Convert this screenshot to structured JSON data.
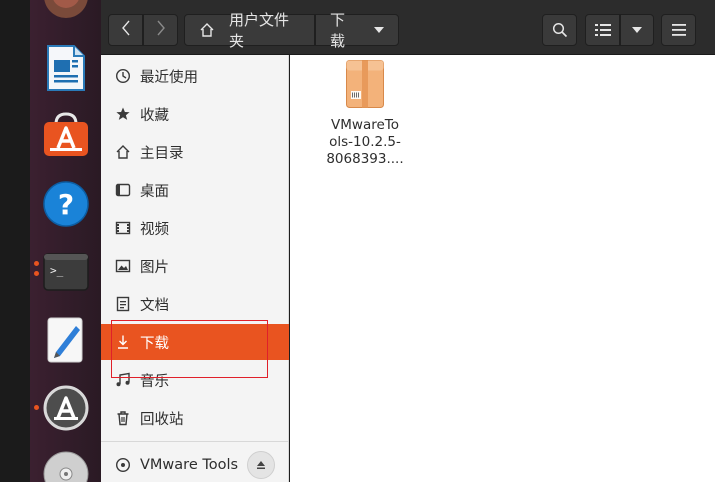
{
  "dock": {
    "items": [
      {
        "name": "trash-app-icon"
      },
      {
        "name": "libreoffice-writer-icon"
      },
      {
        "name": "ubuntu-software-icon"
      },
      {
        "name": "help-icon"
      },
      {
        "name": "terminal-icon"
      },
      {
        "name": "text-editor-icon"
      },
      {
        "name": "software-updater-icon"
      },
      {
        "name": "dvd-drive-icon"
      }
    ],
    "accent": "#e95420"
  },
  "header": {
    "back_icon": "chevron-left-icon",
    "forward_icon": "chevron-right-icon",
    "path": [
      {
        "label": "用户文件夹",
        "icon": "home-icon"
      },
      {
        "label": "下载"
      }
    ],
    "search_icon": "search-icon",
    "view_icon": "list-view-icon",
    "menu_icon": "hamburger-icon"
  },
  "sidebar": {
    "items": [
      {
        "label": "最近使用",
        "icon": "clock-icon"
      },
      {
        "label": "收藏",
        "icon": "star-icon"
      },
      {
        "label": "主目录",
        "icon": "home-icon"
      },
      {
        "label": "桌面",
        "icon": "desktop-icon"
      },
      {
        "label": "视频",
        "icon": "film-icon"
      },
      {
        "label": "图片",
        "icon": "image-icon"
      },
      {
        "label": "文档",
        "icon": "document-icon"
      },
      {
        "label": "下载",
        "icon": "download-icon",
        "active": true
      },
      {
        "label": "音乐",
        "icon": "music-icon"
      },
      {
        "label": "回收站",
        "icon": "trash-icon"
      }
    ],
    "device": {
      "label": "VMware Tools",
      "icon": "disc-icon",
      "eject_icon": "eject-icon"
    }
  },
  "files": [
    {
      "label_lines": [
        "VMwareTo",
        "ols-10.2.5-",
        "8068393...."
      ],
      "icon": "archive-icon"
    }
  ]
}
